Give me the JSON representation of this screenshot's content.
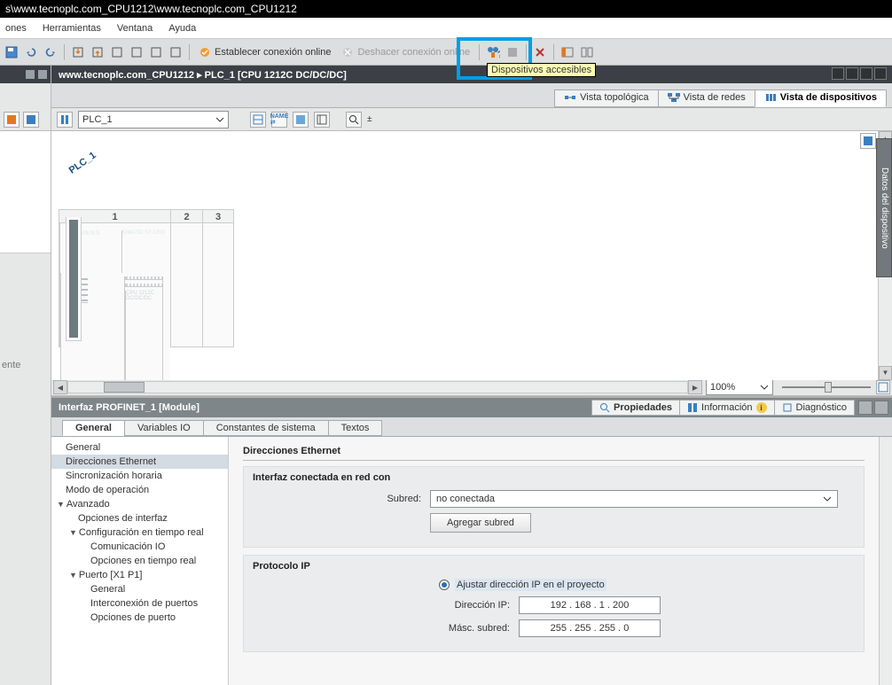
{
  "titlebar": "s\\www.tecnoplc.com_CPU1212\\www.tecnoplc.com_CPU1212",
  "menu": {
    "config": "ones",
    "tools": "Herramientas",
    "window": "Ventana",
    "help": "Ayuda"
  },
  "toolbar": {
    "go_online": "Establecer conexión online",
    "go_offline": "Deshacer conexión online",
    "tooltip": "Dispositivos accesibles"
  },
  "pathbar": "www.tecnoplc.com_CPU1212  ▸  PLC_1 [CPU 1212C DC/DC/DC]",
  "view_tabs": {
    "topology": "Vista topológica",
    "network": "Vista de redes",
    "device": "Vista de dispositivos"
  },
  "dev_toolbar": {
    "plc_select": "PLC_1"
  },
  "canvas": {
    "plc_label": "PLC_1",
    "slots": [
      "1",
      "2",
      "3"
    ],
    "brand": "SIEMENS",
    "model": "SIMATIC S7-1200",
    "cpu_label": "CPU 1212C DC/DC/DC"
  },
  "zoom": {
    "value": "100%"
  },
  "side_rail": "Datos del dispositivo",
  "left_mini": "ente",
  "prop_header": "Interfaz PROFINET_1 [Module]",
  "prop_right_tabs": {
    "props": "Propiedades",
    "info": "Información",
    "diag": "Diagnóstico"
  },
  "prop_sub_tabs": {
    "general": "General",
    "vario": "Variables IO",
    "const": "Constantes de sistema",
    "text": "Textos"
  },
  "prop_tree": {
    "general": "General",
    "eth": "Direcciones Ethernet",
    "sync": "Sincronización horaria",
    "mode": "Modo de operación",
    "adv": "Avanzado",
    "if_opt": "Opciones de interfaz",
    "rt": "Configuración en tiempo real",
    "commio": "Comunicación IO",
    "rtopt": "Opciones en tiempo real",
    "port": "Puerto [X1 P1]",
    "pgen": "General",
    "pinter": "Interconexión de puertos",
    "popt": "Opciones de puerto"
  },
  "prop_form": {
    "section": "Direcciones Ethernet",
    "block1": "Interfaz conectada en red con",
    "subnet_lbl": "Subred:",
    "subnet_val": "no conectada",
    "add_subnet": "Agregar subred",
    "block2": "Protocolo IP",
    "radio1": "Ajustar dirección IP en el proyecto",
    "ip_lbl": "Dirección IP:",
    "ip_val": "192 . 168 . 1     . 200",
    "mask_lbl": "Másc. subred:",
    "mask_val": "255 . 255 . 255 . 0"
  }
}
